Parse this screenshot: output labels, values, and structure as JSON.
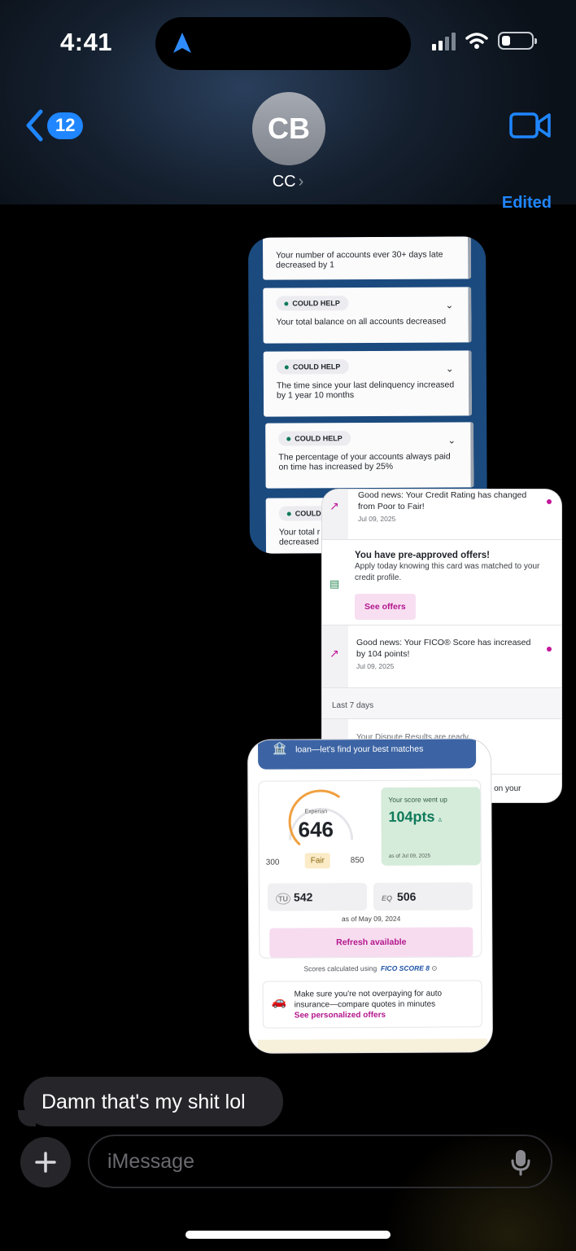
{
  "status_bar": {
    "time": "4:41",
    "location_icon": "location-arrow-icon",
    "signal_icon": "signal-bars-icon",
    "wifi_icon": "wifi-icon",
    "battery_icon": "battery-low-icon"
  },
  "nav": {
    "back_count": "12",
    "avatar_initials": "CB",
    "contact_name": "CC",
    "contact_chevron": "›",
    "video_icon": "video-camera-icon"
  },
  "edited_label": "Edited",
  "card1": {
    "top_row": "Your number of accounts ever 30+ days late decreased by 1",
    "badge": "COULD HELP",
    "badge_partial": "COULD",
    "items": [
      "Your total balance on all accounts decreased",
      "The time since your last delinquency increased by 1 year 10 months",
      "The percentage of your accounts always paid on time has increased by 25%"
    ],
    "partial_text": "Your total r decreased"
  },
  "card2": {
    "n1_title": "Good news: Your Credit Rating has changed from Poor to Fair!",
    "n1_date": "Jul 09, 2025",
    "offer_title": "You have pre-approved offers!",
    "offer_body": "Apply today knowing this card was matched to your credit profile.",
    "offer_button": "See offers",
    "n2_title": "Good news: Your FICO® Score has increased by 104 points!",
    "n2_date": "Jul 09, 2025",
    "section_label": "Last 7 days",
    "n3_partial": "Your Dispute Results are ready",
    "n4_partial": "te on your",
    "accent_color": "#c2179a"
  },
  "card3": {
    "banner_text": "loan—let's find your best matches",
    "bureau": "Experian",
    "score": "646",
    "range_low": "300",
    "range_high": "850",
    "rating": "Fair",
    "went_up_label": "Your score went up",
    "went_up_value": "104pts",
    "went_up_date": "as of Jul 09, 2025",
    "tu_score": "542",
    "eq_label": "EQ",
    "eq_score": "506",
    "as_of": "as of May 09, 2024",
    "refresh_label": "Refresh available",
    "calc_label": "Scores calculated using",
    "fico_label": "FICO SCORE 8",
    "insurance_text": "Make sure you're not overpaying for auto insurance—compare quotes in minutes",
    "insurance_link": "See personalized offers",
    "score_fraction": 0.63
  },
  "message": {
    "text": "Damn that's my shit lol"
  },
  "composer": {
    "placeholder": "iMessage",
    "plus_icon": "plus-icon",
    "mic_icon": "microphone-icon"
  },
  "colors": {
    "ios_blue": "#1f86ff",
    "bubble_gray": "#26252a",
    "fico_green": "#0f7a5a",
    "brand_pink": "#b3168d"
  }
}
